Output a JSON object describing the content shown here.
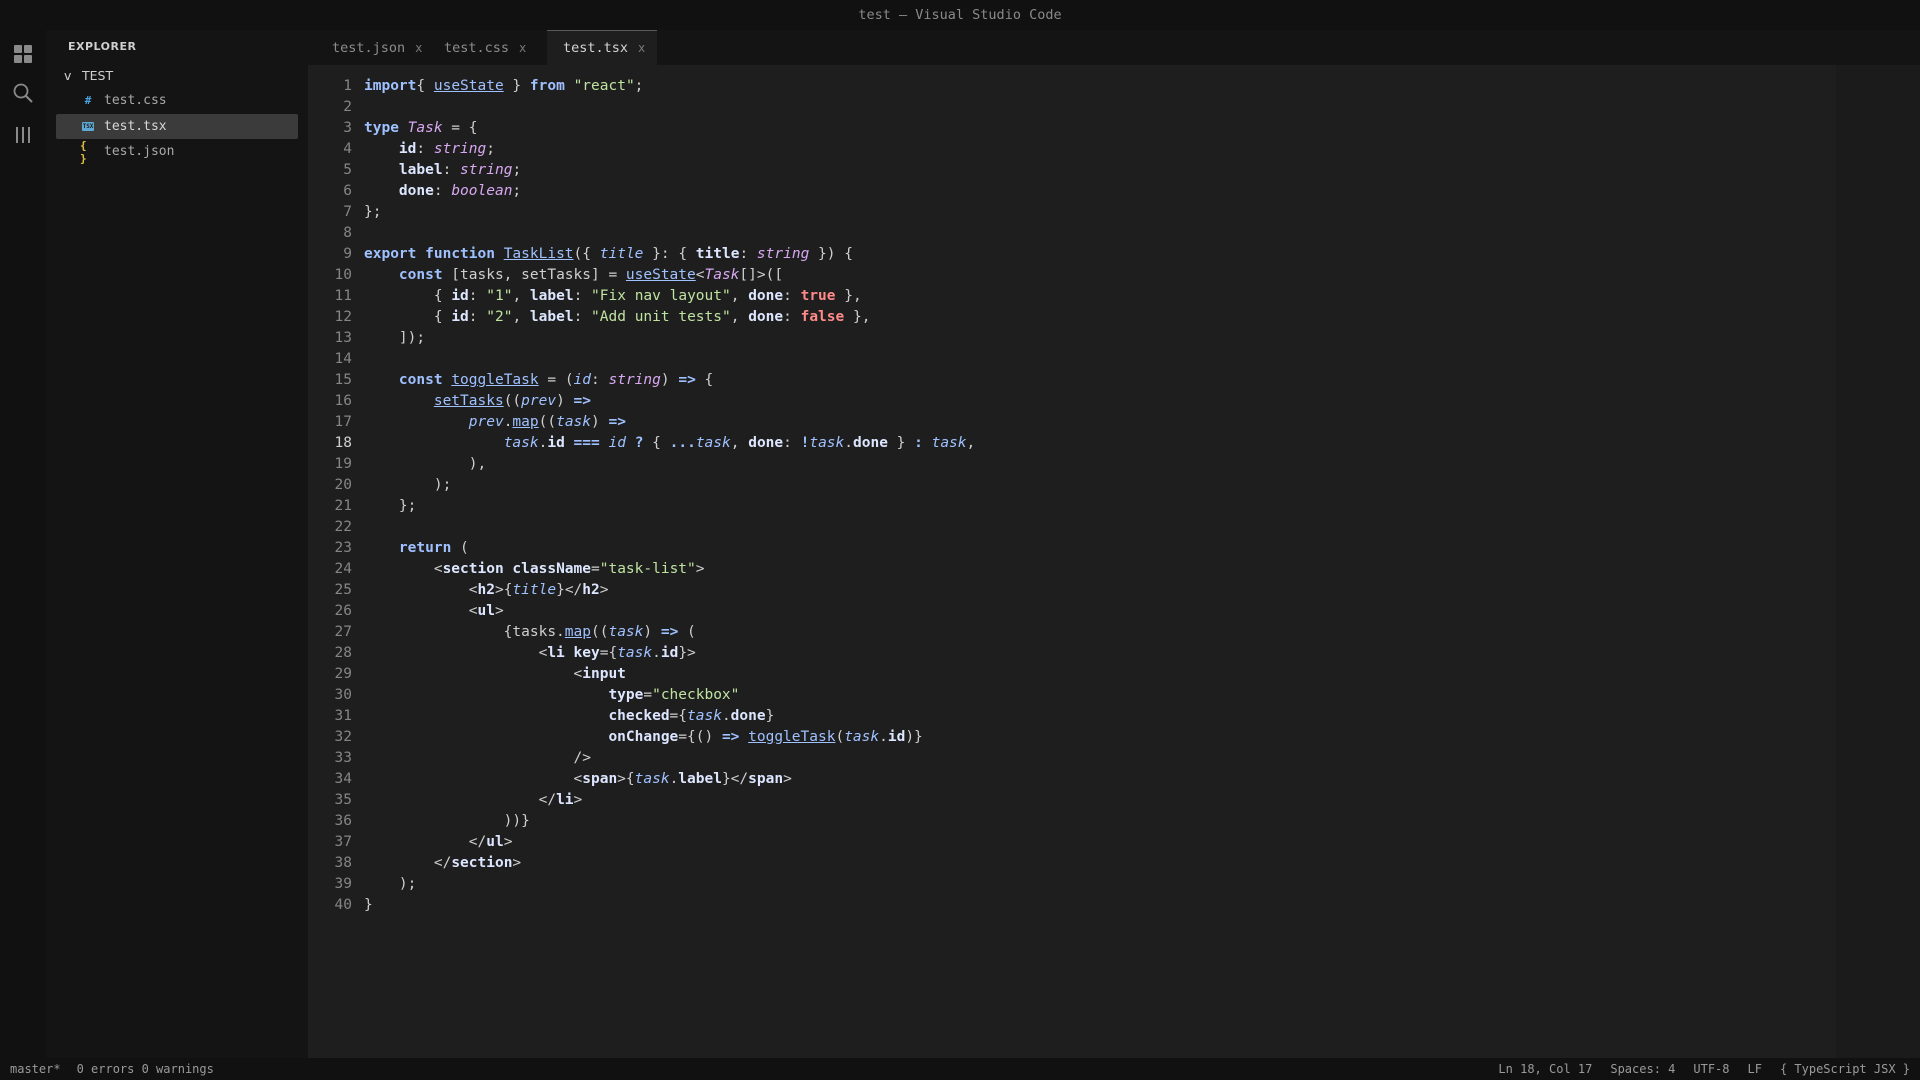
{
  "window": {
    "title": "test — Visual Studio Code"
  },
  "activity_bar": {
    "icons": [
      "explorer-icon",
      "search-icon",
      "extensions-icon"
    ]
  },
  "sidebar": {
    "title": "EXPLORER",
    "folder": {
      "chevron": "v",
      "name": "TEST"
    },
    "files": [
      {
        "icon_text": "#",
        "icon_color": "#4aa3df",
        "name": "test.css",
        "active": false
      },
      {
        "icon_text": "TSX",
        "icon_color": "#5fa8d3",
        "name": "test.tsx",
        "active": true
      },
      {
        "icon_text": "{ }",
        "icon_color": "#e2c044",
        "name": "test.json",
        "active": false
      }
    ]
  },
  "tabs": [
    {
      "label": "test.json",
      "close": "x",
      "active": false
    },
    {
      "label": "test.css",
      "close": "x",
      "active": false
    },
    {
      "label": "test.tsx",
      "close": "x",
      "active": true
    }
  ],
  "editor": {
    "current_line": 18,
    "line_numbers": [
      "1",
      "2",
      "3",
      "4",
      "5",
      "6",
      "7",
      "8",
      "9",
      "10",
      "11",
      "12",
      "13",
      "14",
      "15",
      "16",
      "17",
      "18",
      "19",
      "20",
      "21",
      "22",
      "23",
      "24",
      "25",
      "26",
      "27",
      "28",
      "29",
      "30",
      "31",
      "32",
      "33",
      "34",
      "35",
      "36",
      "37",
      "38",
      "39",
      "40"
    ],
    "lines": [
      [
        [
          "kw",
          "import"
        ],
        [
          "",
          "{ "
        ],
        [
          "fn",
          "useState"
        ],
        [
          "",
          " } "
        ],
        [
          "kw",
          "from"
        ],
        [
          "",
          " "
        ],
        [
          "str",
          "\"react\""
        ],
        [
          "",
          ";"
        ]
      ],
      [],
      [
        [
          "kw",
          "type"
        ],
        [
          "",
          " "
        ],
        [
          "ty",
          "Task"
        ],
        [
          "",
          " = {"
        ]
      ],
      [
        [
          "",
          "    "
        ],
        [
          "pr",
          "id"
        ],
        [
          "",
          ": "
        ],
        [
          "ty",
          "string"
        ],
        [
          "",
          ";"
        ]
      ],
      [
        [
          "",
          "    "
        ],
        [
          "pr",
          "label"
        ],
        [
          "",
          ": "
        ],
        [
          "ty",
          "string"
        ],
        [
          "",
          ";"
        ]
      ],
      [
        [
          "",
          "    "
        ],
        [
          "pr",
          "done"
        ],
        [
          "",
          ": "
        ],
        [
          "ty",
          "boolean"
        ],
        [
          "",
          ";"
        ]
      ],
      [
        [
          "",
          "};"
        ]
      ],
      [],
      [
        [
          "kw",
          "export"
        ],
        [
          "",
          " "
        ],
        [
          "kw",
          "function"
        ],
        [
          "",
          " "
        ],
        [
          "fn",
          "TaskList"
        ],
        [
          "",
          "({ "
        ],
        [
          "it",
          "title"
        ],
        [
          "",
          " }: { "
        ],
        [
          "pr",
          "title"
        ],
        [
          "",
          ": "
        ],
        [
          "ty",
          "string"
        ],
        [
          "",
          " }) {"
        ]
      ],
      [
        [
          "",
          "    "
        ],
        [
          "kw",
          "const"
        ],
        [
          "",
          " [tasks, setTasks] = "
        ],
        [
          "fn",
          "useState"
        ],
        [
          "",
          "<"
        ],
        [
          "ty",
          "Task"
        ],
        [
          "",
          "[]>(["
        ]
      ],
      [
        [
          "",
          "        { "
        ],
        [
          "pr",
          "id"
        ],
        [
          "",
          ": "
        ],
        [
          "str",
          "\"1\""
        ],
        [
          "",
          ", "
        ],
        [
          "pr",
          "label"
        ],
        [
          "",
          ": "
        ],
        [
          "str",
          "\"Fix nav layout\""
        ],
        [
          "",
          ", "
        ],
        [
          "pr",
          "done"
        ],
        [
          "",
          ": "
        ],
        [
          "bool",
          "true"
        ],
        [
          "",
          " },"
        ]
      ],
      [
        [
          "",
          "        { "
        ],
        [
          "pr",
          "id"
        ],
        [
          "",
          ": "
        ],
        [
          "str",
          "\"2\""
        ],
        [
          "",
          ", "
        ],
        [
          "pr",
          "label"
        ],
        [
          "",
          ": "
        ],
        [
          "str",
          "\"Add unit tests\""
        ],
        [
          "",
          ", "
        ],
        [
          "pr",
          "done"
        ],
        [
          "",
          ": "
        ],
        [
          "bool",
          "false"
        ],
        [
          "",
          " },"
        ]
      ],
      [
        [
          "",
          "    ]);"
        ]
      ],
      [],
      [
        [
          "",
          "    "
        ],
        [
          "kw",
          "const"
        ],
        [
          "",
          " "
        ],
        [
          "fn",
          "toggleTask"
        ],
        [
          "",
          " = ("
        ],
        [
          "it",
          "id"
        ],
        [
          "",
          ": "
        ],
        [
          "ty",
          "string"
        ],
        [
          "",
          ") "
        ],
        [
          "kw",
          "=>"
        ],
        [
          "",
          " {"
        ]
      ],
      [
        [
          "",
          "        "
        ],
        [
          "fn",
          "setTasks"
        ],
        [
          "",
          "(("
        ],
        [
          "it",
          "prev"
        ],
        [
          "",
          ") "
        ],
        [
          "kw",
          "=>"
        ]
      ],
      [
        [
          "",
          "            "
        ],
        [
          "it",
          "prev"
        ],
        [
          "",
          "."
        ],
        [
          "fn",
          "map"
        ],
        [
          "",
          "(("
        ],
        [
          "it",
          "task"
        ],
        [
          "",
          ") "
        ],
        [
          "kw",
          "=>"
        ]
      ],
      [
        [
          "",
          "                "
        ],
        [
          "it",
          "task"
        ],
        [
          "",
          "."
        ],
        [
          "pr",
          "id"
        ],
        [
          "",
          " "
        ],
        [
          "kw",
          "==="
        ],
        [
          "",
          " "
        ],
        [
          "it",
          "id"
        ],
        [
          "",
          " "
        ],
        [
          "kw",
          "?"
        ],
        [
          "",
          " { "
        ],
        [
          "kw",
          "..."
        ],
        [
          "it",
          "task"
        ],
        [
          "",
          ", "
        ],
        [
          "pr",
          "done"
        ],
        [
          "",
          ": "
        ],
        [
          "kw",
          "!"
        ],
        [
          "it",
          "task"
        ],
        [
          "",
          "."
        ],
        [
          "pr",
          "done"
        ],
        [
          "",
          " } "
        ],
        [
          "kw",
          ":"
        ],
        [
          "",
          " "
        ],
        [
          "it",
          "task"
        ],
        [
          "",
          ","
        ]
      ],
      [
        [
          "",
          "            ),"
        ]
      ],
      [
        [
          "",
          "        );"
        ]
      ],
      [
        [
          "",
          "    };"
        ]
      ],
      [],
      [
        [
          "",
          "    "
        ],
        [
          "kw",
          "return"
        ],
        [
          "",
          " ("
        ]
      ],
      [
        [
          "",
          "        <"
        ],
        [
          "tg",
          "section"
        ],
        [
          "",
          " "
        ],
        [
          "pr",
          "className"
        ],
        [
          "",
          "="
        ],
        [
          "str",
          "\"task-list\""
        ],
        [
          "",
          ">"
        ]
      ],
      [
        [
          "",
          "            <"
        ],
        [
          "tg",
          "h2"
        ],
        [
          "",
          ">{"
        ],
        [
          "it",
          "title"
        ],
        [
          "",
          "}</"
        ],
        [
          "tg",
          "h2"
        ],
        [
          "",
          ">"
        ]
      ],
      [
        [
          "",
          "            <"
        ],
        [
          "tg",
          "ul"
        ],
        [
          "",
          ">"
        ]
      ],
      [
        [
          "",
          "                {tasks."
        ],
        [
          "fn",
          "map"
        ],
        [
          "",
          "(("
        ],
        [
          "it",
          "task"
        ],
        [
          "",
          ") "
        ],
        [
          "kw",
          "=>"
        ],
        [
          "",
          " ("
        ]
      ],
      [
        [
          "",
          "                    <"
        ],
        [
          "tg",
          "li"
        ],
        [
          "",
          " "
        ],
        [
          "pr",
          "key"
        ],
        [
          "",
          "={"
        ],
        [
          "it",
          "task"
        ],
        [
          "",
          "."
        ],
        [
          "pr",
          "id"
        ],
        [
          "",
          "}>"
        ]
      ],
      [
        [
          "",
          "                        <"
        ],
        [
          "tg",
          "input"
        ]
      ],
      [
        [
          "",
          "                            "
        ],
        [
          "pr",
          "type"
        ],
        [
          "",
          "="
        ],
        [
          "str",
          "\"checkbox\""
        ]
      ],
      [
        [
          "",
          "                            "
        ],
        [
          "pr",
          "checked"
        ],
        [
          "",
          "={"
        ],
        [
          "it",
          "task"
        ],
        [
          "",
          "."
        ],
        [
          "pr",
          "done"
        ],
        [
          "",
          "}"
        ]
      ],
      [
        [
          "",
          "                            "
        ],
        [
          "pr",
          "onChange"
        ],
        [
          "",
          "={() "
        ],
        [
          "kw",
          "=>"
        ],
        [
          "",
          " "
        ],
        [
          "fn",
          "toggleTask"
        ],
        [
          "",
          "("
        ],
        [
          "it",
          "task"
        ],
        [
          "",
          "."
        ],
        [
          "pr",
          "id"
        ],
        [
          "",
          ")}"
        ]
      ],
      [
        [
          "",
          "                        />"
        ]
      ],
      [
        [
          "",
          "                        <"
        ],
        [
          "tg",
          "span"
        ],
        [
          "",
          ">{"
        ],
        [
          "it",
          "task"
        ],
        [
          "",
          "."
        ],
        [
          "pr",
          "label"
        ],
        [
          "",
          "}</"
        ],
        [
          "tg",
          "span"
        ],
        [
          "",
          ">"
        ]
      ],
      [
        [
          "",
          "                    </"
        ],
        [
          "tg",
          "li"
        ],
        [
          "",
          ">"
        ]
      ],
      [
        [
          "",
          "                ))}"
        ]
      ],
      [
        [
          "",
          "            </"
        ],
        [
          "tg",
          "ul"
        ],
        [
          "",
          ">"
        ]
      ],
      [
        [
          "",
          "        </"
        ],
        [
          "tg",
          "section"
        ],
        [
          "",
          ">"
        ]
      ],
      [
        [
          "",
          "    );"
        ]
      ],
      [
        [
          "",
          "}"
        ]
      ]
    ]
  },
  "status_bar": {
    "branch": "master*",
    "problems": "0 errors 0 warnings",
    "position": "Ln 18, Col 17",
    "indent": "Spaces: 4",
    "encoding": "UTF-8",
    "eol": "LF",
    "language": "{ TypeScript JSX }"
  }
}
